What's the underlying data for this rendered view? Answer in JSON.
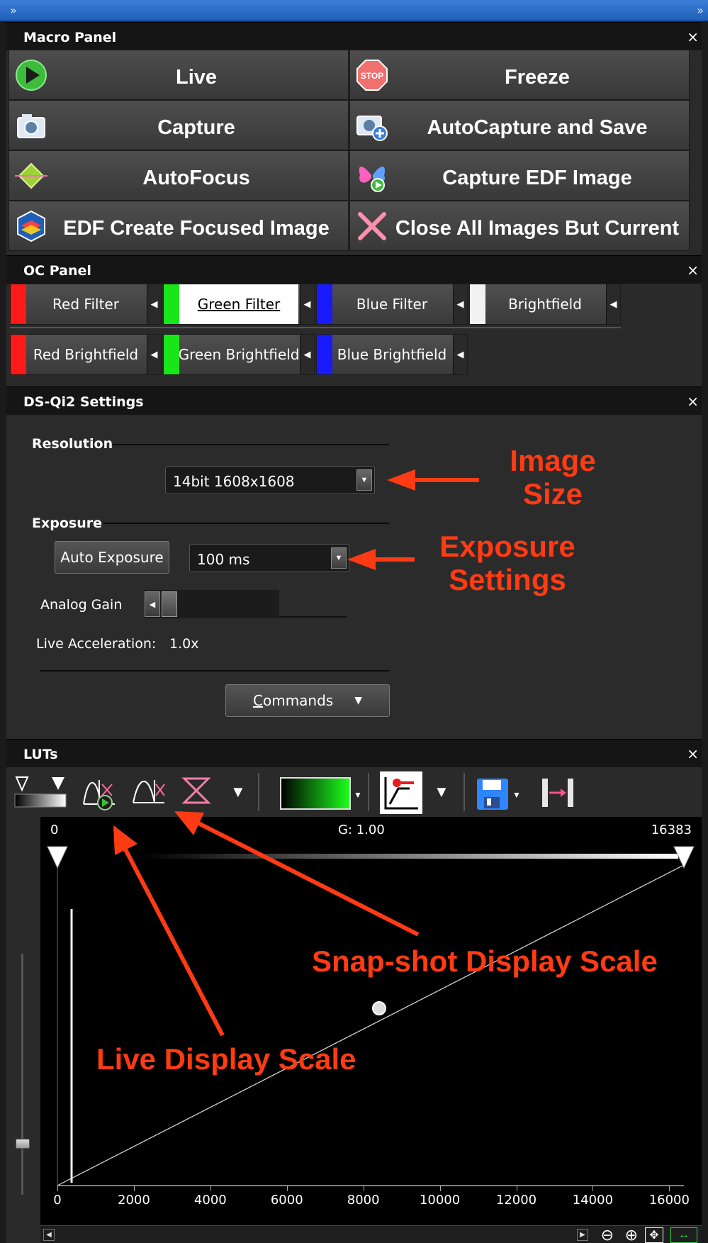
{
  "topbar": {
    "left_glyph": "»",
    "right_glyph": "»"
  },
  "macro_panel": {
    "title": "Macro Panel",
    "close": "×",
    "buttons": [
      {
        "label": "Live",
        "icon": "play-icon"
      },
      {
        "label": "Freeze",
        "icon": "stop-icon"
      },
      {
        "label": "Capture",
        "icon": "camera-icon"
      },
      {
        "label": "AutoCapture and Save",
        "icon": "camera-plus-icon"
      },
      {
        "label": "AutoFocus",
        "icon": "autofocus-icon"
      },
      {
        "label": "Capture EDF Image",
        "icon": "butterfly-icon"
      },
      {
        "label": "EDF Create Focused Image",
        "icon": "edf-stack-icon"
      },
      {
        "label": "Close All Images But Current",
        "icon": "close-x-icon"
      }
    ],
    "stop_text": "STOP"
  },
  "oc_panel": {
    "title": "OC Panel",
    "close": "×",
    "buttons": [
      {
        "label": "Red Filter",
        "color": "#ff1a1a",
        "active": false
      },
      {
        "label": "Green Filter",
        "color": "#19e619",
        "active": true
      },
      {
        "label": "Blue Filter",
        "color": "#1a1aff",
        "active": false
      },
      {
        "label": "Brightfield",
        "color": "#f2f2f2",
        "active": false
      },
      {
        "label": "Red Brightfield",
        "color": "#ff1a1a",
        "active": false
      },
      {
        "label": "Green Brightfield",
        "color": "#19e619",
        "active": false
      },
      {
        "label": "Blue Brightfield",
        "color": "#1a1aff",
        "active": false
      }
    ]
  },
  "ds_settings": {
    "title": "DS-Qi2 Settings",
    "close": "×",
    "resolution_label": "Resolution",
    "resolution_value": "14bit 1608x1608",
    "exposure_label": "Exposure",
    "auto_exposure": "Auto Exposure",
    "exposure_value": "100 ms",
    "analog_gain_label": "Analog Gain",
    "live_accel_label": "Live Acceleration:",
    "live_accel_value": "1.0x",
    "commands_accel": "C",
    "commands_rest": "ommands"
  },
  "annotations": {
    "image_size_1": "Image",
    "image_size_2": "Size",
    "exposure_1": "Exposure",
    "exposure_2": "Settings",
    "snapshot": "Snap-shot Display Scale",
    "live": "Live Display Scale",
    "color": "#ff3b14"
  },
  "luts": {
    "title": "LUTs",
    "close": "×",
    "min_value": "0",
    "gamma": "G: 1.00",
    "max_value": "16383",
    "x_ticks": [
      "0",
      "2000",
      "4000",
      "6000",
      "8000",
      "10000",
      "12000",
      "14000",
      "16000"
    ]
  }
}
